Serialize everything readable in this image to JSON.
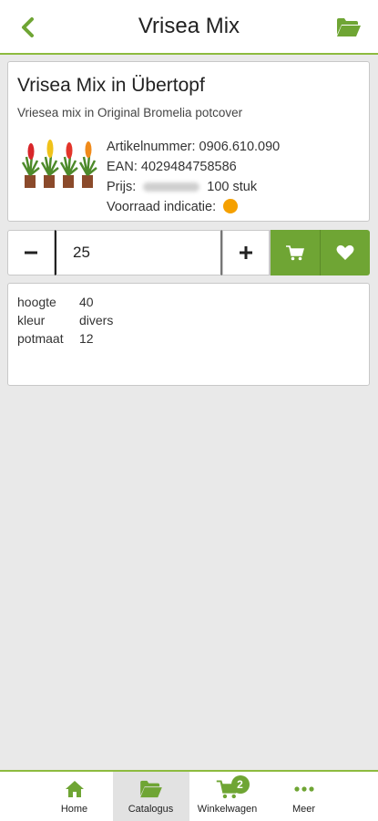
{
  "header": {
    "title": "Vrisea Mix",
    "back_icon": "chevron-left-icon",
    "folder_icon": "folder-open-icon",
    "accent_color": "#8dbb3f"
  },
  "product": {
    "title": "Vrisea Mix in Übertopf",
    "subtitle": "Vriesea mix in Original Bromelia potcover",
    "article_label": "Artikelnummer:",
    "article_number": "0906.610.090",
    "ean_label": "EAN:",
    "ean": "4029484758586",
    "price_label": "Prijs:",
    "price_unit": "100 stuk",
    "stock_label": "Voorraad indicatie:",
    "stock_color": "#f5a000"
  },
  "quantity": {
    "value": "25",
    "minus_label": "−",
    "plus_label": "+",
    "button_color": "#6fa534"
  },
  "properties": [
    {
      "key": "hoogte",
      "value": "40"
    },
    {
      "key": "kleur",
      "value": "divers"
    },
    {
      "key": "potmaat",
      "value": "12"
    }
  ],
  "tabbar": {
    "items": [
      {
        "label": "Home",
        "icon": "home-icon"
      },
      {
        "label": "Catalogus",
        "icon": "folder-open-icon"
      },
      {
        "label": "Winkelwagen",
        "icon": "cart-icon"
      },
      {
        "label": "Meer",
        "icon": "more-icon"
      }
    ],
    "active": "Catalogus",
    "cart_count": "2"
  }
}
